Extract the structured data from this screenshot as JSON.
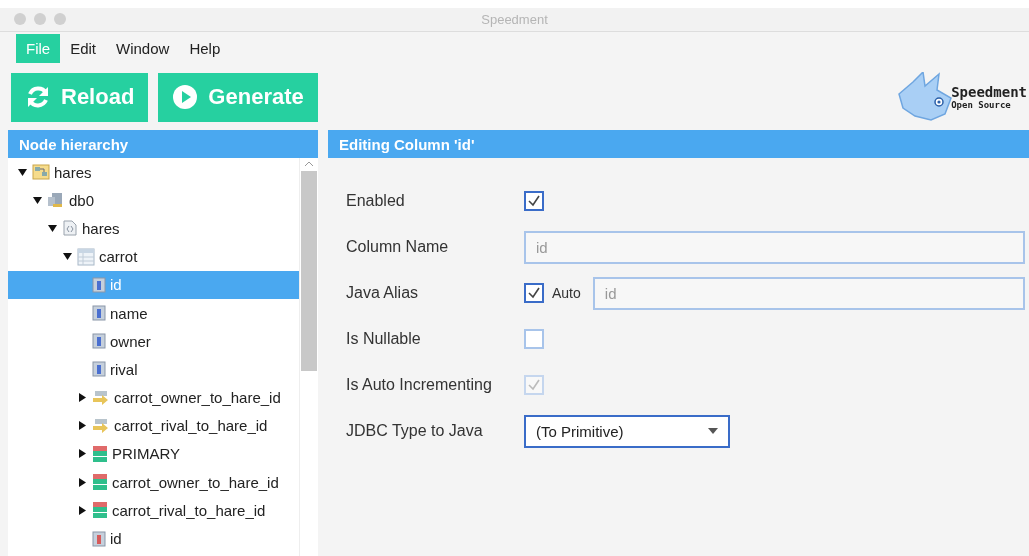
{
  "window": {
    "title": "Speedment"
  },
  "menu": [
    {
      "label": "File",
      "selected": true
    },
    {
      "label": "Edit",
      "selected": false
    },
    {
      "label": "Window",
      "selected": false
    },
    {
      "label": "Help",
      "selected": false
    }
  ],
  "toolbar": [
    {
      "label": "Reload",
      "kind": "reload"
    },
    {
      "label": "Generate",
      "kind": "play"
    }
  ],
  "logo": {
    "name": "Speedment",
    "tagline": "Open Source"
  },
  "tree": {
    "title": "Node hierarchy",
    "nodes": [
      {
        "label": "hares",
        "kind": "project",
        "expanded": true,
        "selected": false,
        "children": [
          {
            "label": "db0",
            "kind": "dbms",
            "expanded": true,
            "selected": false,
            "children": [
              {
                "label": "hares",
                "kind": "schema",
                "expanded": true,
                "selected": false,
                "children": [
                  {
                    "label": "carrot",
                    "kind": "table",
                    "expanded": true,
                    "selected": false,
                    "children": [
                      {
                        "label": "id",
                        "kind": "column",
                        "selected": true
                      },
                      {
                        "label": "name",
                        "kind": "column",
                        "selected": false
                      },
                      {
                        "label": "owner",
                        "kind": "column",
                        "selected": false
                      },
                      {
                        "label": "rival",
                        "kind": "column",
                        "selected": false
                      },
                      {
                        "label": "carrot_owner_to_hare_id",
                        "kind": "foreign_key",
                        "expanded": false,
                        "selected": false
                      },
                      {
                        "label": "carrot_rival_to_hare_id",
                        "kind": "foreign_key",
                        "expanded": false,
                        "selected": false
                      },
                      {
                        "label": "PRIMARY",
                        "kind": "index",
                        "expanded": false,
                        "selected": false
                      },
                      {
                        "label": "carrot_owner_to_hare_id",
                        "kind": "index",
                        "expanded": false,
                        "selected": false
                      },
                      {
                        "label": "carrot_rival_to_hare_id",
                        "kind": "index",
                        "expanded": false,
                        "selected": false
                      },
                      {
                        "label": "id",
                        "kind": "primary_key",
                        "selected": false
                      }
                    ]
                  }
                ]
              }
            ]
          }
        ]
      }
    ]
  },
  "editor": {
    "title": "Editing Column 'id'",
    "rows": [
      {
        "label": "Enabled",
        "kind": "checkbox",
        "checked": true,
        "disabled": false
      },
      {
        "label": "Column Name",
        "kind": "text",
        "placeholder": "id"
      },
      {
        "label": "Java Alias",
        "kind": "checkbox_text",
        "checked": true,
        "disabled": false,
        "check_label": "Auto",
        "placeholder": "id"
      },
      {
        "label": "Is Nullable",
        "kind": "checkbox",
        "checked": false,
        "disabled": false
      },
      {
        "label": "Is Auto Incrementing",
        "kind": "checkbox",
        "checked": true,
        "disabled": true
      },
      {
        "label": "JDBC Type to Java",
        "kind": "select",
        "value": "(To Primitive)"
      }
    ]
  }
}
